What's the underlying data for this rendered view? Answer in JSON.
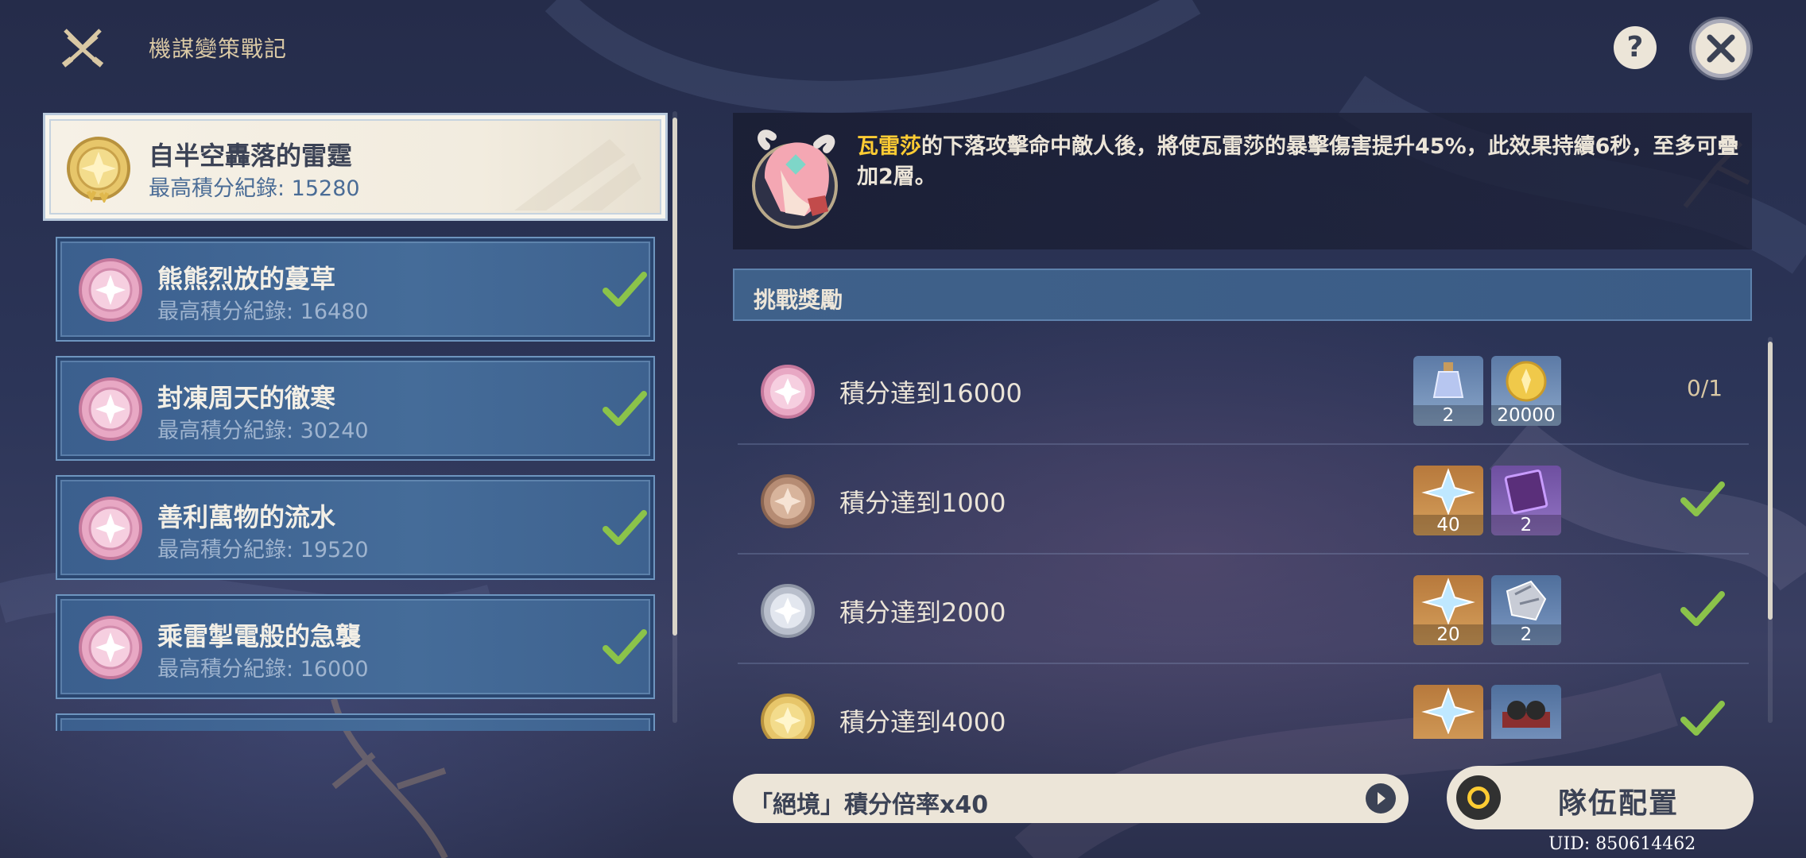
{
  "header": {
    "title": "機謀變策戰記",
    "icon": "crossed-swords-icon",
    "help_label": "?",
    "close_icon": "close-icon"
  },
  "stages": [
    {
      "name": "自半空轟落的雷霆",
      "record": "最高積分紀錄: 15280",
      "selected": true,
      "badge": "gold",
      "completed": false
    },
    {
      "name": "熊熊烈放的蔓草",
      "record": "最高積分紀錄: 16480",
      "selected": false,
      "badge": "pink",
      "completed": true
    },
    {
      "name": "封凍周天的徹寒",
      "record": "最高積分紀錄: 30240",
      "selected": false,
      "badge": "pink",
      "completed": true
    },
    {
      "name": "善利萬物的流水",
      "record": "最高積分紀錄: 19520",
      "selected": false,
      "badge": "pink",
      "completed": true
    },
    {
      "name": "乘雷掣電般的急襲",
      "record": "最高積分紀錄: 16000",
      "selected": false,
      "badge": "pink",
      "completed": true
    }
  ],
  "description": {
    "character": "瓦雷莎",
    "text": "的下落攻擊命中敵人後，將使瓦雷莎的暴擊傷害提升45%，此效果持續6秒，至多可疊加2層。"
  },
  "rewards": {
    "header": "挑戰獎勵",
    "rows": [
      {
        "label": "積分達到16000",
        "badge": "pink",
        "items": [
          {
            "type": "potion",
            "count": "2"
          },
          {
            "type": "mora",
            "count": "20000"
          }
        ],
        "progress": "0/1",
        "completed": false
      },
      {
        "label": "積分達到1000",
        "badge": "bronze",
        "items": [
          {
            "type": "primogem",
            "count": "40"
          },
          {
            "type": "book",
            "count": "2"
          }
        ],
        "progress": "",
        "completed": true
      },
      {
        "label": "積分達到2000",
        "badge": "silver",
        "items": [
          {
            "type": "primogem",
            "count": "20"
          },
          {
            "type": "ore",
            "count": "2"
          }
        ],
        "progress": "",
        "completed": true
      },
      {
        "label": "積分達到4000",
        "badge": "gold",
        "items": [
          {
            "type": "primogem",
            "count": ""
          },
          {
            "type": "material",
            "count": ""
          }
        ],
        "progress": "",
        "completed": true
      }
    ]
  },
  "footer": {
    "difficulty_label": "「絕境」積分倍率x40",
    "team_button": "隊伍配置",
    "uid": "UID: 850614462"
  },
  "colors": {
    "accent_gold": "#ffcc33",
    "check_green": "#8bc34a",
    "panel_cream": "#ece5d8",
    "card_blue": "#456c99"
  }
}
